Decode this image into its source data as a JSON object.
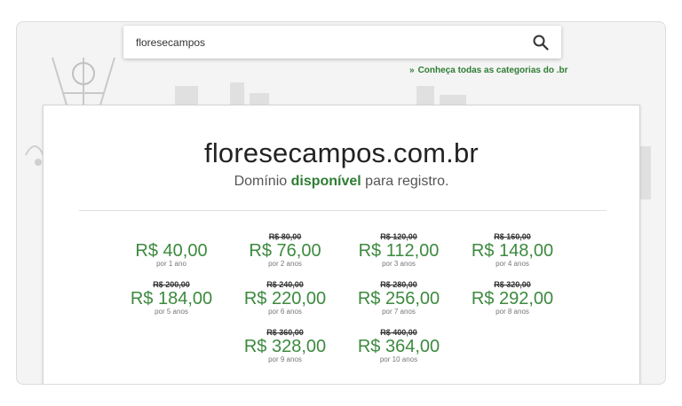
{
  "search": {
    "value": "floresecampos",
    "icon": "search-icon"
  },
  "categories_link": {
    "arrow": "»",
    "label": "Conheça todas as categorias do .br"
  },
  "result": {
    "domain": "floresecampos.com.br",
    "status_prefix": "Domínio",
    "status_highlight": "disponível",
    "status_suffix": "para registro."
  },
  "prices": [
    {
      "old": "",
      "price": "R$ 40,00",
      "period": "por 1 ano"
    },
    {
      "old": "R$ 80,00",
      "price": "R$ 76,00",
      "period": "por 2 anos"
    },
    {
      "old": "R$ 120,00",
      "price": "R$ 112,00",
      "period": "por 3 anos"
    },
    {
      "old": "R$ 160,00",
      "price": "R$ 148,00",
      "period": "por 4 anos"
    },
    {
      "old": "R$ 200,00",
      "price": "R$ 184,00",
      "period": "por 5 anos"
    },
    {
      "old": "R$ 240,00",
      "price": "R$ 220,00",
      "period": "por 6 anos"
    },
    {
      "old": "R$ 280,00",
      "price": "R$ 256,00",
      "period": "por 7 anos"
    },
    {
      "old": "R$ 320,00",
      "price": "R$ 292,00",
      "period": "por 8 anos"
    },
    {
      "old": "R$ 360,00",
      "price": "R$ 328,00",
      "period": "por 9 anos"
    },
    {
      "old": "R$ 400,00",
      "price": "R$ 364,00",
      "period": "por 10 anos"
    }
  ],
  "colors": {
    "green": "#2e7d32",
    "price_green": "#3d8a3f",
    "background": "#f4f4f4"
  }
}
